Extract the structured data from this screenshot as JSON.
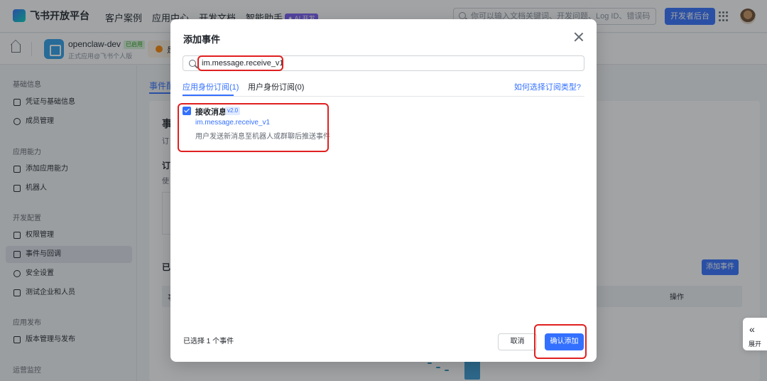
{
  "topnav": {
    "logo": "飞书开放平台",
    "links": [
      "客户案例",
      "应用中心",
      "开发文档",
      "智能助手"
    ],
    "ai_badge": "✦ AI 开发",
    "search_placeholder": "你可以输入文档关键词、开发问题、Log ID、错误码",
    "dev_console": "开发者后台"
  },
  "appbar": {
    "app_name": "openclaw-dev",
    "status": "已启用",
    "subtitle": "正式应用@飞书个人版",
    "warn_text": "是"
  },
  "sidebar": {
    "groups": [
      {
        "title": "基础信息",
        "items": [
          "凭证与基础信息",
          "成员管理"
        ]
      },
      {
        "title": "应用能力",
        "items": [
          "添加应用能力",
          "机器人"
        ]
      },
      {
        "title": "开发配置",
        "items": [
          "权限管理",
          "事件与回调",
          "安全设置",
          "测试企业和人员"
        ]
      },
      {
        "title": "应用发布",
        "items": [
          "版本管理与发布"
        ]
      },
      {
        "title": "运营监控",
        "items": []
      }
    ],
    "active_item": "事件与回调"
  },
  "background": {
    "tab": "事件配",
    "heading": "事",
    "sub1": "订",
    "sub2": "订",
    "sub3": "使",
    "section": "已",
    "add_event_button": "添加事件",
    "table_ops_header": "操作",
    "table_first_col": "事"
  },
  "modal": {
    "title": "添加事件",
    "search_value": "im.message.receive_v1",
    "tabs": [
      {
        "label": "应用身份订阅(1)",
        "active": true
      },
      {
        "label": "用户身份订阅(0)",
        "active": false
      }
    ],
    "help_link": "如何选择订阅类型?",
    "events": [
      {
        "checked": true,
        "name": "接收消息",
        "version": "v2.0",
        "key": "im.message.receive_v1",
        "description": "用户发送新消息至机器人或群聊后推送事件"
      }
    ],
    "selected_count": "已选择 1 个事件",
    "cancel_label": "取消",
    "confirm_label": "确认添加"
  },
  "expand_tab": {
    "label": "展开"
  },
  "colors": {
    "accent": "#3370ff",
    "annotation": "#e02020"
  }
}
